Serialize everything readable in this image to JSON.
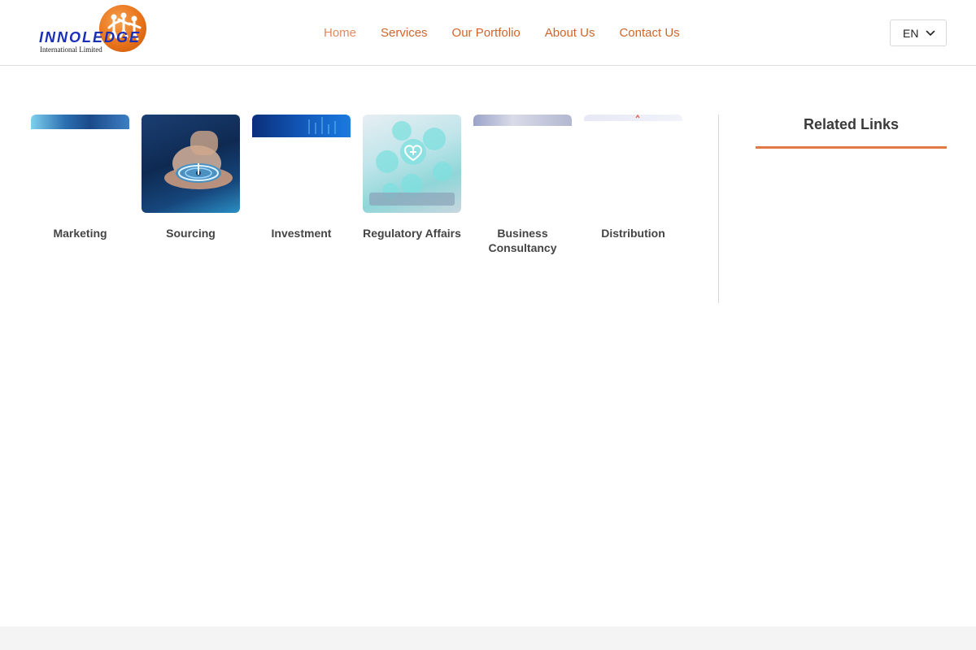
{
  "brand": {
    "name": "INNOLEDGE",
    "subtitle": "International Limited"
  },
  "nav": {
    "items": [
      "Home",
      "Services",
      "Our Portfolio",
      "About Us",
      "Contact Us"
    ],
    "active": "Home"
  },
  "language": {
    "selected": "EN",
    "icon": "chevron-down-icon"
  },
  "services": [
    {
      "label": "Marketing"
    },
    {
      "label": "Sourcing"
    },
    {
      "label": "Investment"
    },
    {
      "label": "Regulatory Affairs"
    },
    {
      "label": "Business Consultancy"
    },
    {
      "label": "Distribution"
    }
  ],
  "sidebar": {
    "title": "Related Links"
  },
  "colors": {
    "accent": "#d0652a",
    "brand_blue": "#1a2fb8",
    "rule": "#e07a45"
  }
}
